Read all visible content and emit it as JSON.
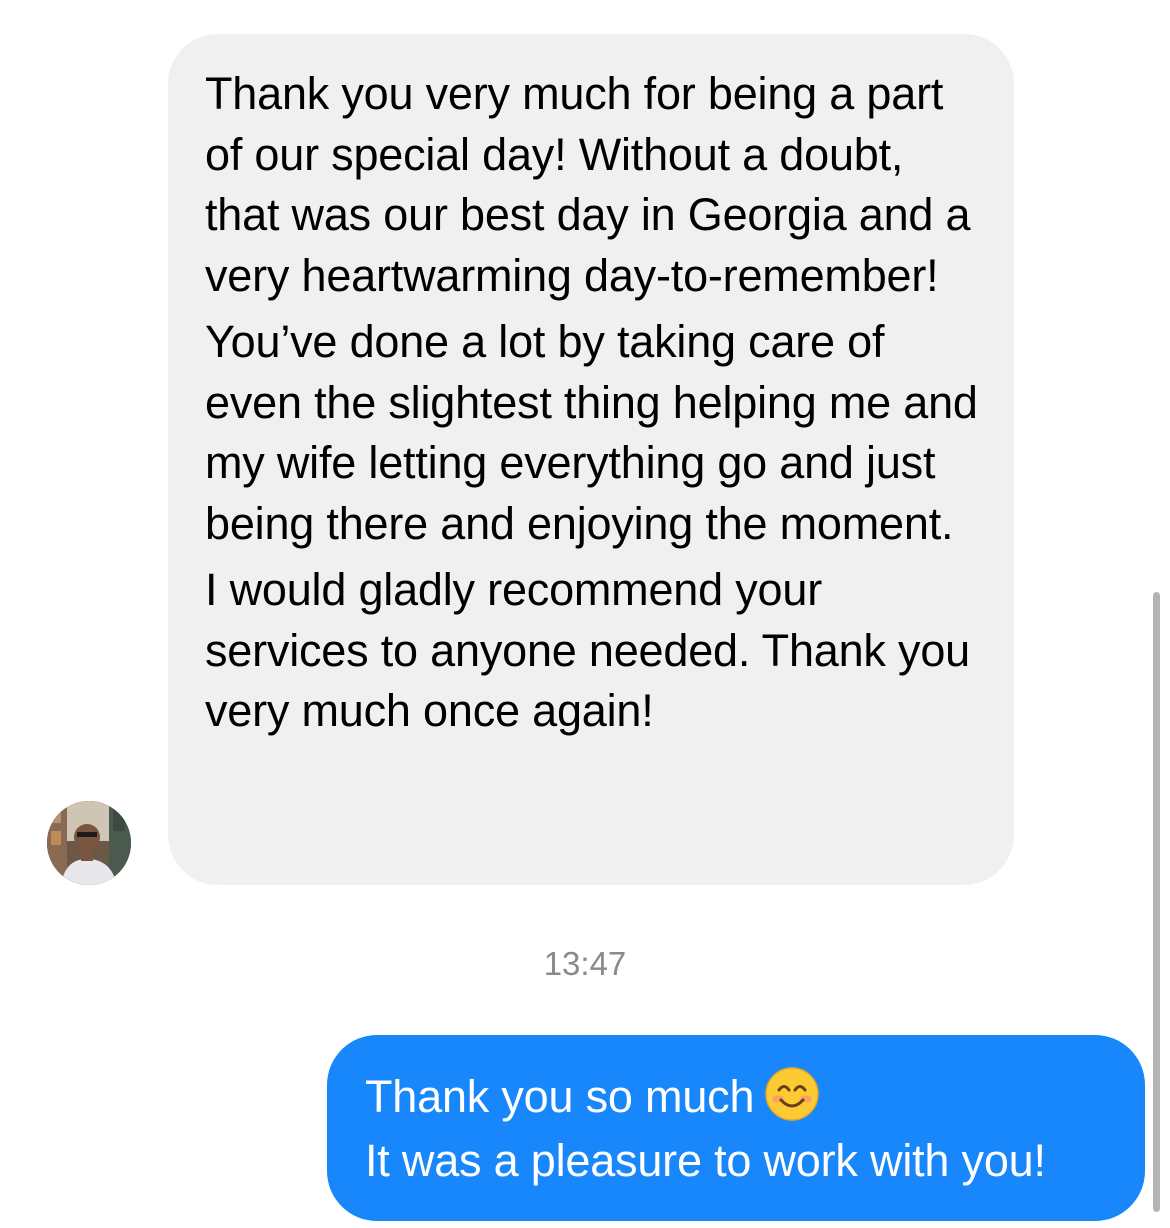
{
  "conversation": {
    "incoming": {
      "paragraphs": [
        "Thank you very much for being a part of our special day! Without a doubt, that was our best day in Georgia and a very heartwarming day-to-remember!",
        "You’ve done a lot by taking care of even the slightest thing helping me and my wife letting everything go and just being there and enjoying the moment.",
        "I would gladly recommend your services to anyone needed. Thank you very much once again!"
      ],
      "avatar_icon": "contact-avatar"
    },
    "timestamp": "13:47",
    "outgoing": {
      "line1": "Thank you so much",
      "line1_emoji": "smiling-face-icon",
      "line2": "It was a pleasure to work with you!"
    }
  },
  "colors": {
    "incoming_bubble": "#f0f0f0",
    "outgoing_bubble": "#1787fb",
    "timestamp_text": "#8a8a8e",
    "scrollbar": "#b4b4b8"
  }
}
